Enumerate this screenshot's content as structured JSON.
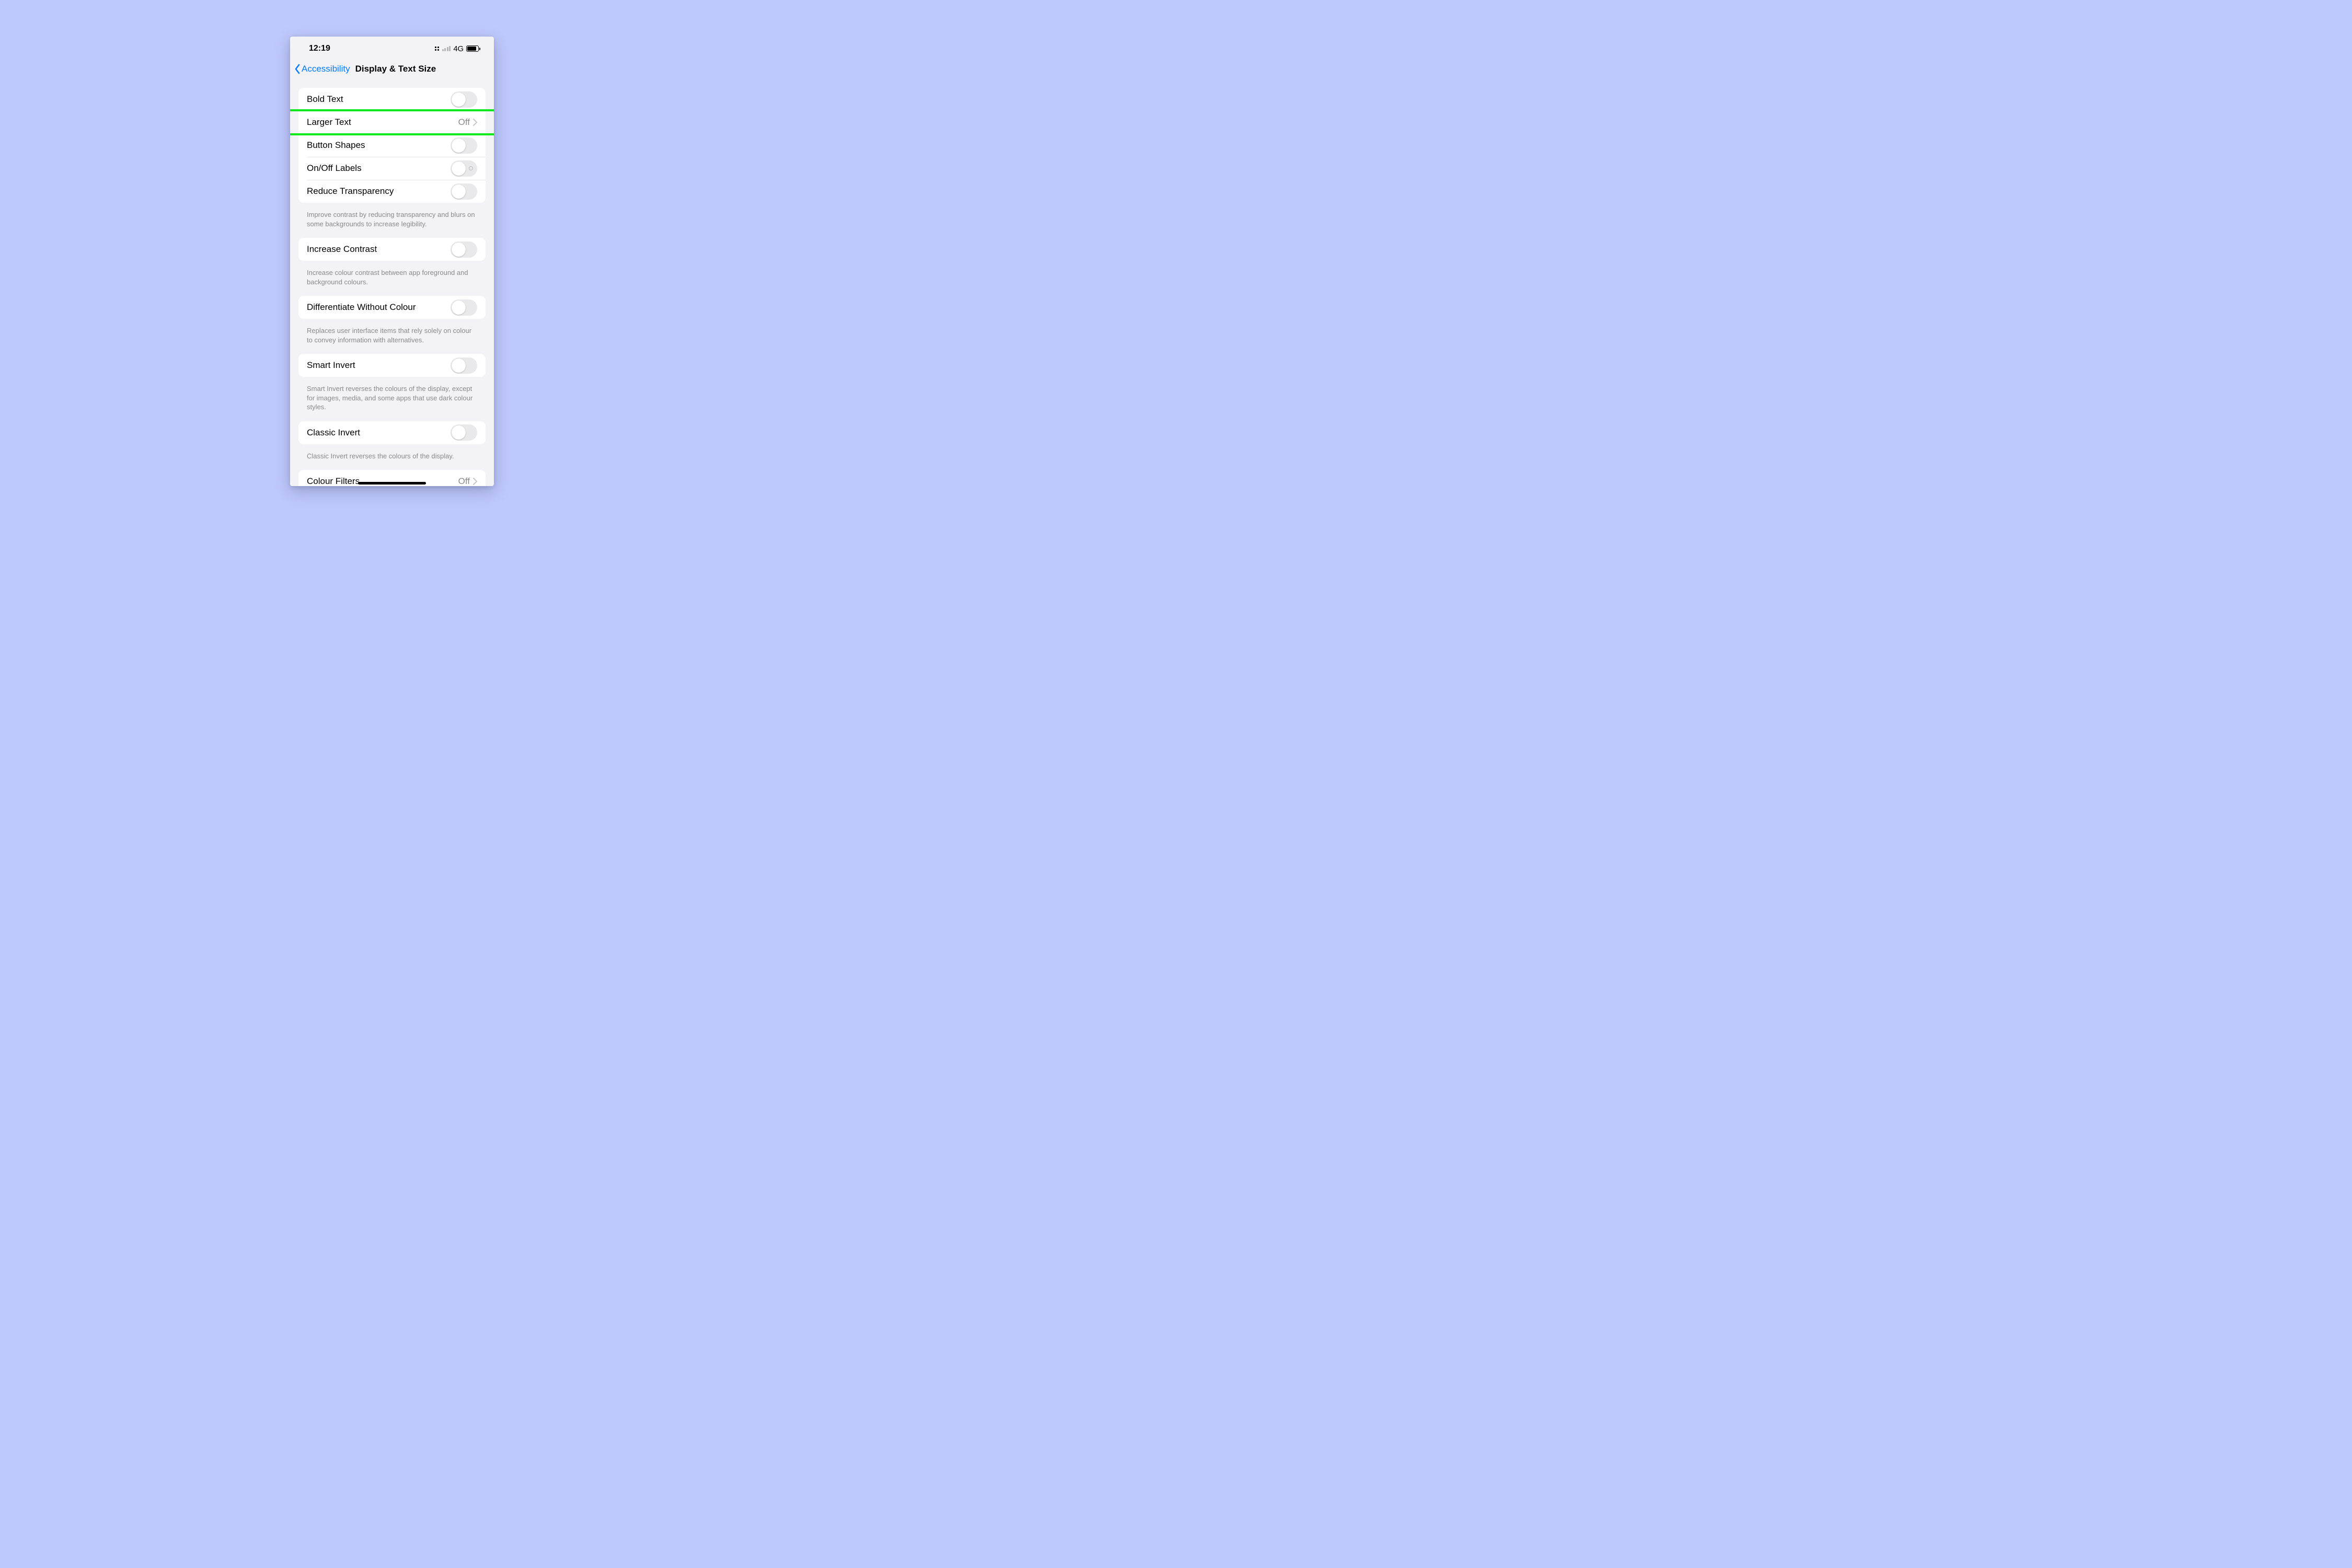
{
  "statusbar": {
    "time": "12:19",
    "network_label": "4G"
  },
  "navbar": {
    "back_label": "Accessibility",
    "title": "Display & Text Size"
  },
  "groups": [
    {
      "rows": [
        {
          "id": "bold-text",
          "label": "Bold Text",
          "control": "switch"
        },
        {
          "id": "larger-text",
          "label": "Larger Text",
          "control": "nav",
          "value": "Off",
          "highlighted": true
        },
        {
          "id": "button-shapes",
          "label": "Button Shapes",
          "control": "switch"
        },
        {
          "id": "on-off-labels",
          "label": "On/Off Labels",
          "control": "switch",
          "on_off_marker": true
        },
        {
          "id": "reduce-transparency",
          "label": "Reduce Transparency",
          "control": "switch"
        }
      ],
      "footer": "Improve contrast by reducing transparency and blurs on some backgrounds to increase legibility."
    },
    {
      "rows": [
        {
          "id": "increase-contrast",
          "label": "Increase Contrast",
          "control": "switch"
        }
      ],
      "footer": "Increase colour contrast between app foreground and background colours."
    },
    {
      "rows": [
        {
          "id": "differentiate-without-colour",
          "label": "Differentiate Without Colour",
          "control": "switch"
        }
      ],
      "footer": "Replaces user interface items that rely solely on colour to convey information with alternatives."
    },
    {
      "rows": [
        {
          "id": "smart-invert",
          "label": "Smart Invert",
          "control": "switch"
        }
      ],
      "footer": "Smart Invert reverses the colours of the display, except for images, media, and some apps that use dark colour styles."
    },
    {
      "rows": [
        {
          "id": "classic-invert",
          "label": "Classic Invert",
          "control": "switch"
        }
      ],
      "footer": "Classic Invert reverses the colours of the display."
    },
    {
      "rows": [
        {
          "id": "colour-filters",
          "label": "Colour Filters",
          "control": "nav",
          "value": "Off"
        }
      ]
    }
  ]
}
